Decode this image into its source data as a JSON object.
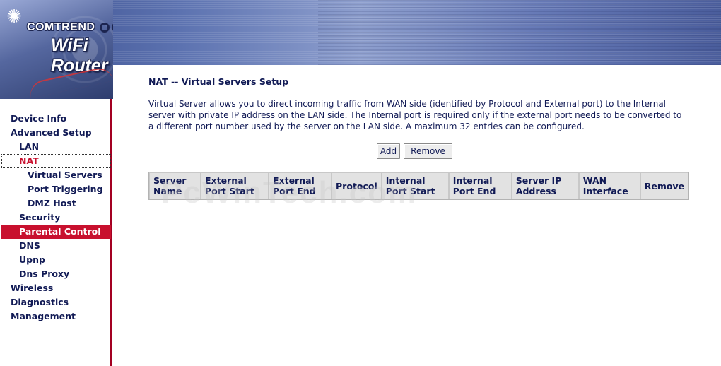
{
  "header": {
    "brand": "COMTREND",
    "product": "WiFi Router",
    "logo_icon": "sun-burst-icon"
  },
  "sidebar": {
    "items": [
      {
        "label": "Device Info",
        "level": 1
      },
      {
        "label": "Advanced Setup",
        "level": 1
      },
      {
        "label": "LAN",
        "level": 2
      },
      {
        "label": "NAT",
        "level": 2,
        "state": "current"
      },
      {
        "label": "Virtual Servers",
        "level": 3
      },
      {
        "label": "Port Triggering",
        "level": 3
      },
      {
        "label": "DMZ Host",
        "level": 3
      },
      {
        "label": "Security",
        "level": 2
      },
      {
        "label": "Parental Control",
        "level": 2,
        "state": "highlight"
      },
      {
        "label": "DNS",
        "level": 2
      },
      {
        "label": "Upnp",
        "level": 2
      },
      {
        "label": "Dns Proxy",
        "level": 2
      },
      {
        "label": "Wireless",
        "level": 1
      },
      {
        "label": "Diagnostics",
        "level": 1
      },
      {
        "label": "Management",
        "level": 1
      }
    ]
  },
  "main": {
    "title": "NAT -- Virtual Servers Setup",
    "description": "Virtual Server allows you to direct incoming traffic from WAN side (identified by Protocol and External port) to the Internal server with private IP address on the LAN side. The Internal port is required only if the external port needs to be converted to a different port number used by the server on the LAN side. A maximum 32 entries can be configured.",
    "buttons": {
      "add": "Add",
      "remove": "Remove"
    },
    "table": {
      "columns": [
        "Server Name",
        "External Port Start",
        "External Port End",
        "Protocol",
        "Internal Port Start",
        "Internal Port End",
        "Server IP Address",
        "WAN Interface",
        "Remove"
      ]
    }
  },
  "watermark": "PcWinTech.com",
  "colors": {
    "accent": "#c8102e",
    "text": "#111a55",
    "sidebar_border": "#a30022",
    "table_header_bg": "#e2e2e2"
  }
}
